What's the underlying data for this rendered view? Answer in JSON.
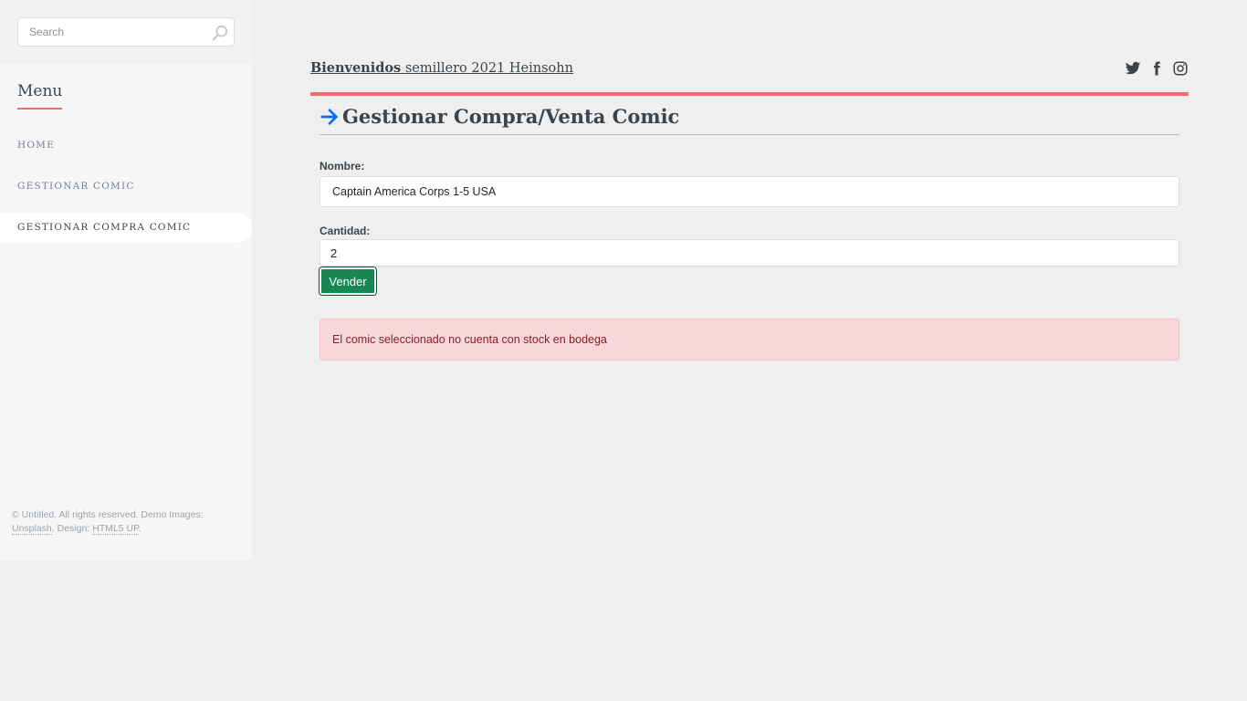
{
  "search": {
    "placeholder": "Search"
  },
  "sidebar": {
    "menu_title": "Menu",
    "items": [
      {
        "label": "HOME"
      },
      {
        "label": "GESTIONAR COMIC"
      },
      {
        "label": "GESTIONAR COMPRA COMIC"
      }
    ],
    "footer": {
      "prefix": "© Untitled. All rights reserved. Demo Images: ",
      "unsplash": "Unsplash",
      "design_prefix": ". Design: ",
      "html5up": "HTML5 UP",
      "suffix": "."
    }
  },
  "header": {
    "title_bold": "Bienvenidos",
    "title_rest": " semillero 2021 Heinsohn",
    "social": [
      "twitter-icon",
      "facebook-icon",
      "instagram-icon"
    ]
  },
  "main": {
    "title": "Gestionar Compra/Venta Comic",
    "form": {
      "nombre_label": "Nombre:",
      "nombre_value": "Captain America Corps 1-5 USA",
      "cantidad_label": "Cantidad:",
      "cantidad_value": "2",
      "submit_label": "Vender"
    },
    "alert": "El comic seleccionado no cuenta con stock en bodega"
  },
  "colors": {
    "accent": "#f56a6a",
    "success": "#198754",
    "alert_bg": "#f8d7da",
    "alert_text": "#842029",
    "arrow": "#0d6efd"
  }
}
